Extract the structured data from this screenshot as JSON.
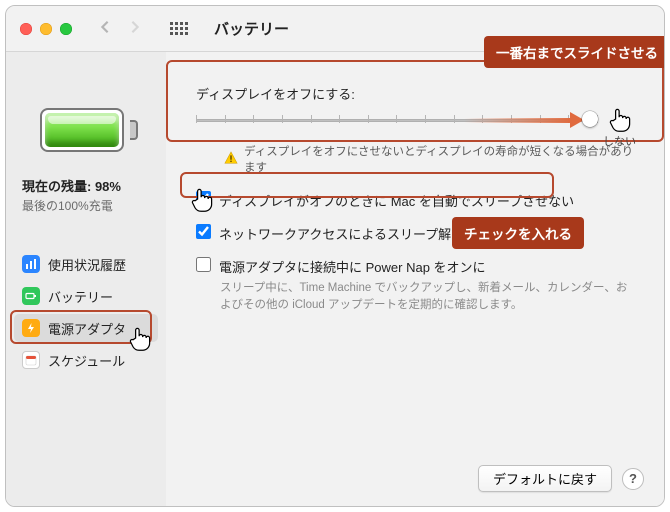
{
  "window": {
    "title": "バッテリー"
  },
  "sidebar": {
    "status_now": "現在の残量: 98%",
    "status_last": "最後の100%充電",
    "items": [
      {
        "label": "使用状況履歴"
      },
      {
        "label": "バッテリー"
      },
      {
        "label": "電源アダプタ"
      },
      {
        "label": "スケジュール"
      }
    ]
  },
  "main": {
    "display_off_label": "ディスプレイをオフにする:",
    "slider_end_label": "しない",
    "warning": "ディスプレイをオフにさせないとディスプレイの寿命が短くなる場合があります",
    "opt_no_sleep": "ディスプレイがオフのときに Mac を自動でスリープさせない",
    "opt_wake_net": "ネットワークアクセスによるスリープ解除",
    "opt_powernap": "電源アダプタに接続中に Power Nap をオンに",
    "powernap_desc": "スリープ中に、Time Machine でバックアップし、新着メール、カレンダー、およびその他の iCloud アップデートを定期的に確認します。"
  },
  "footer": {
    "reset": "デフォルトに戻す",
    "help": "?"
  },
  "annotations": {
    "slide_right": "一番右までスライドさせる",
    "check_it": "チェックを入れる"
  }
}
